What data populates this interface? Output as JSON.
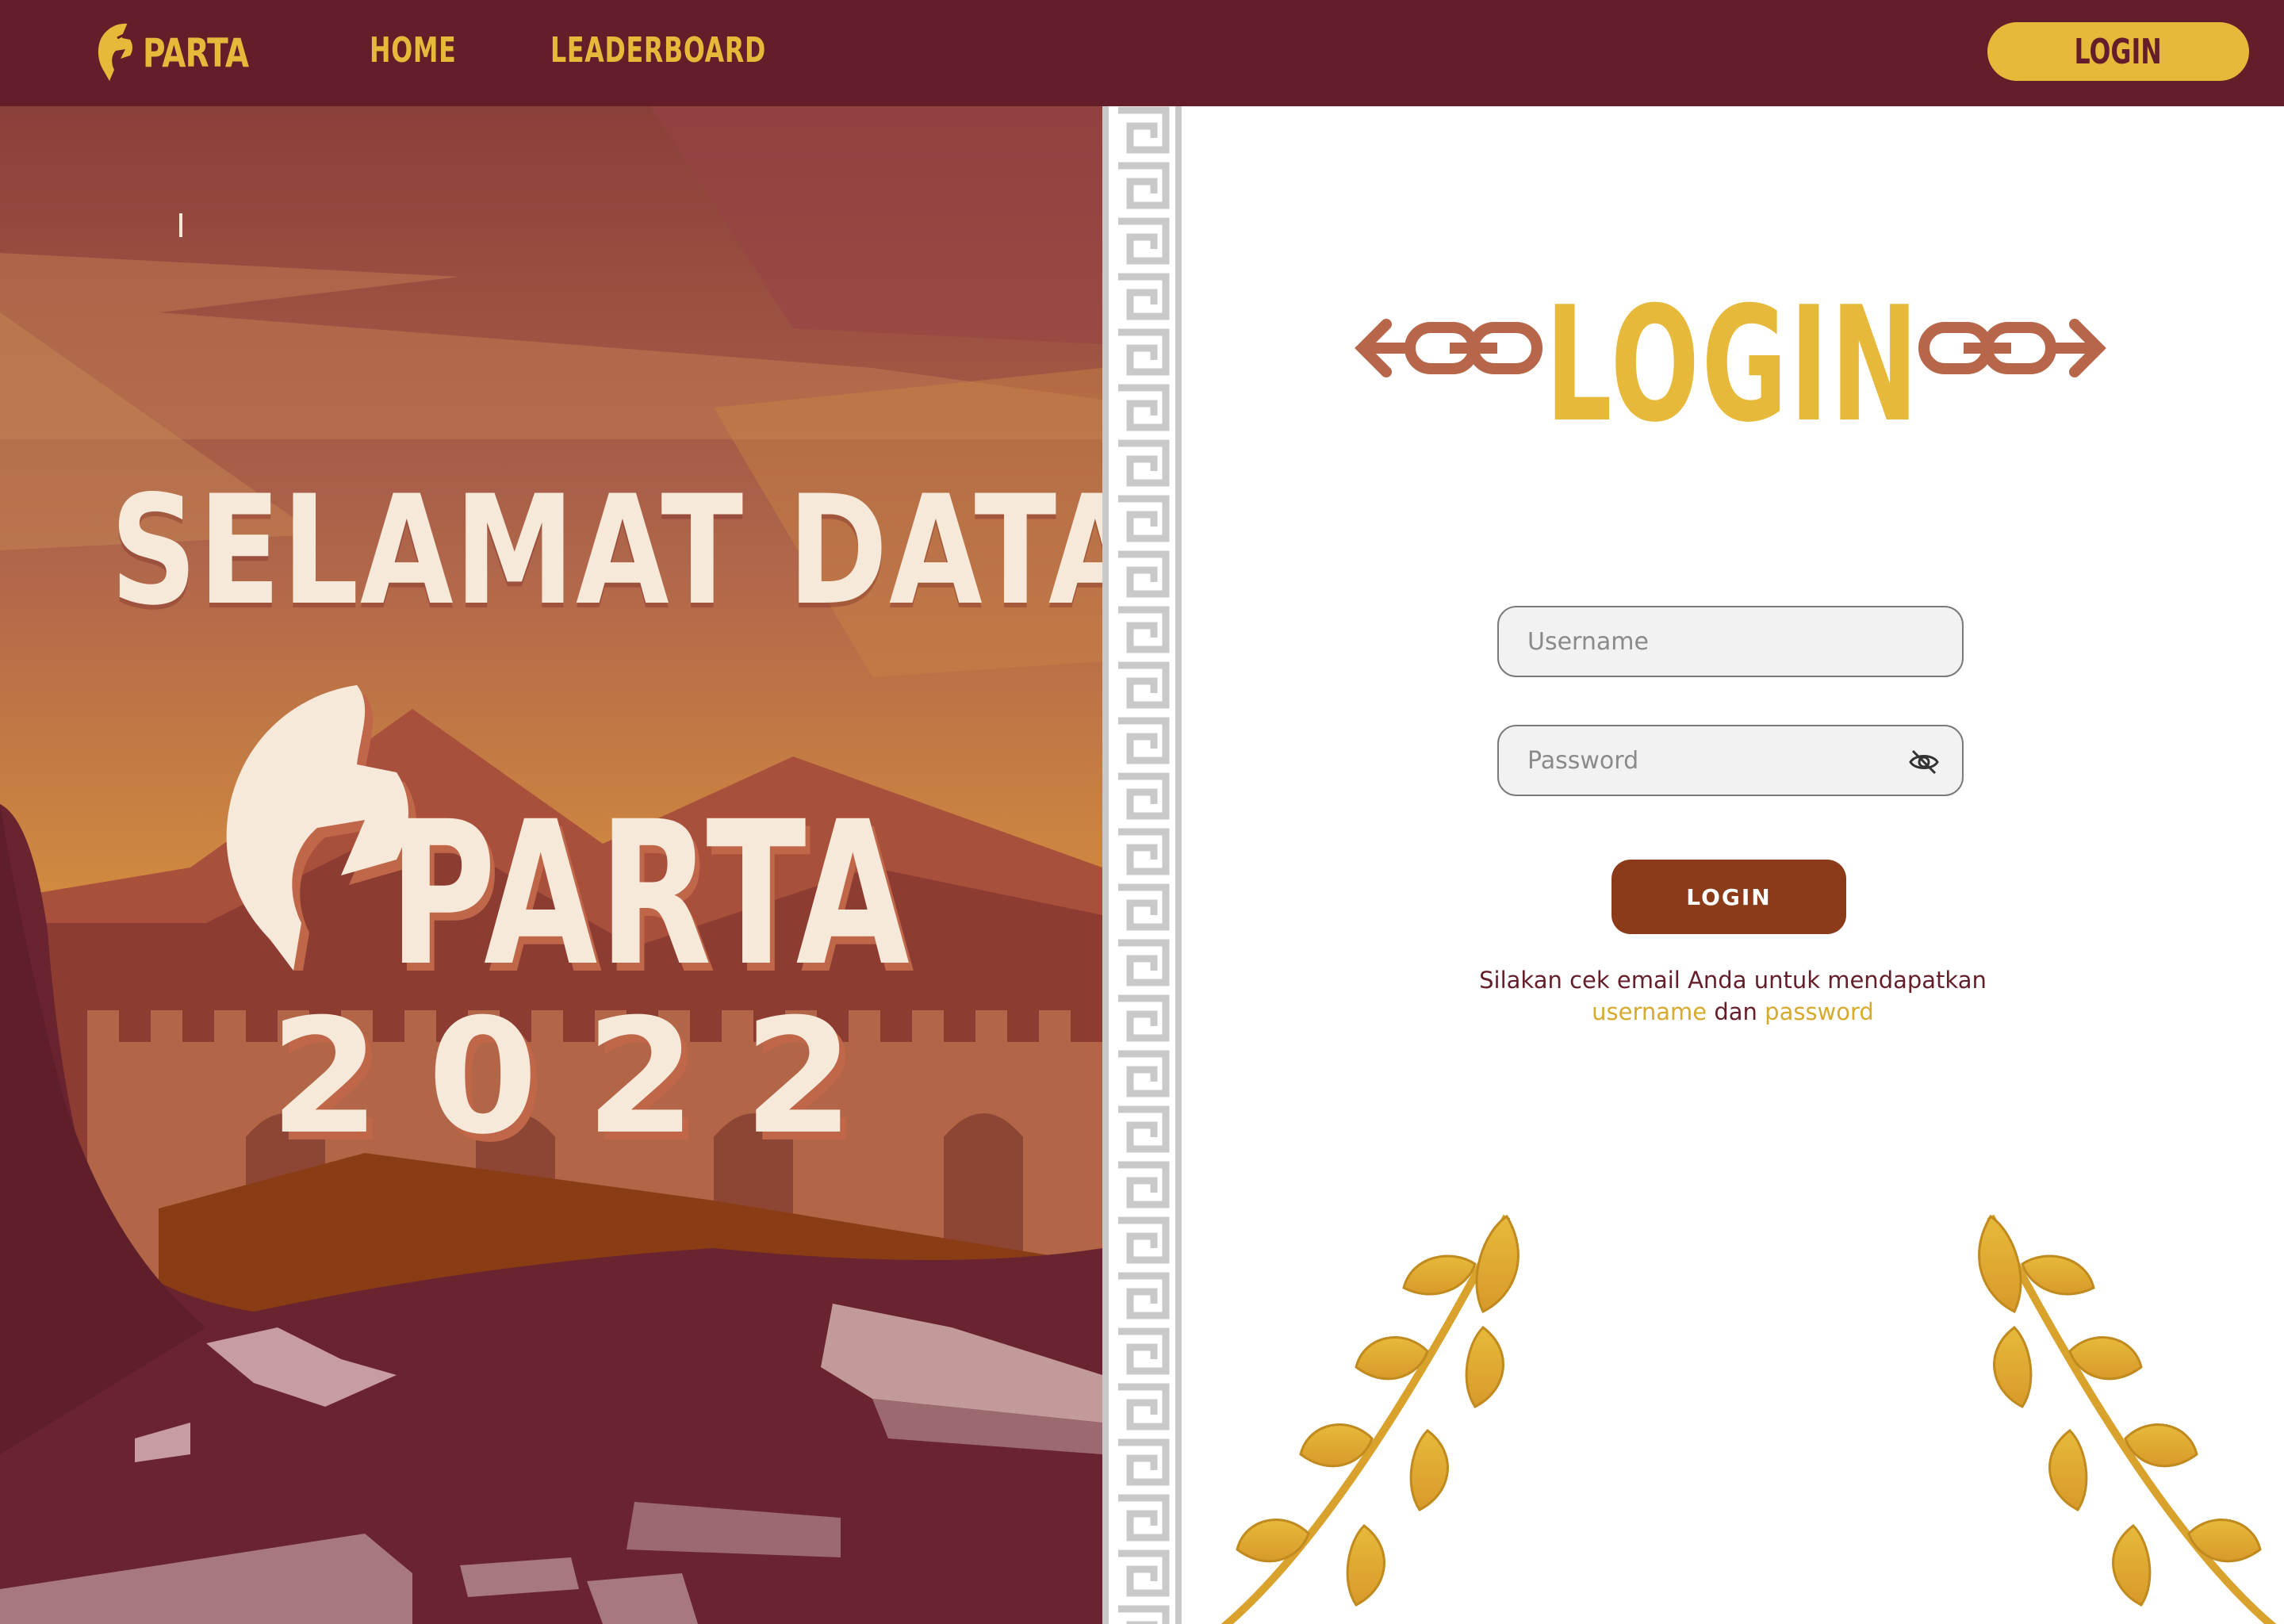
{
  "navbar": {
    "brand": "PARTA",
    "links": [
      {
        "label": "HOME"
      },
      {
        "label": "LEADERBOARD"
      }
    ],
    "login_label": "LOGIN"
  },
  "hero": {
    "welcome": "SELAMAT DATANG",
    "logo_text": "PARTA",
    "year": "2022"
  },
  "login": {
    "title": "LOGIN",
    "username_placeholder": "Username",
    "password_placeholder": "Password",
    "submit_label": "LOGIN",
    "hint_prefix": "Silakan cek email Anda untuk mendapatkan",
    "hint_username": "username",
    "hint_and": "dan",
    "hint_password": "password"
  },
  "colors": {
    "maroon": "#641e29",
    "gold": "#e7b93a",
    "rust": "#8b3a1a",
    "cream": "#f6e9d9"
  },
  "icons": {
    "brand": "spartan-helmet-icon",
    "password_toggle": "eye-off-icon",
    "decor": [
      "chain-arrow-icon",
      "laurel-icon",
      "greek-key-border"
    ]
  }
}
